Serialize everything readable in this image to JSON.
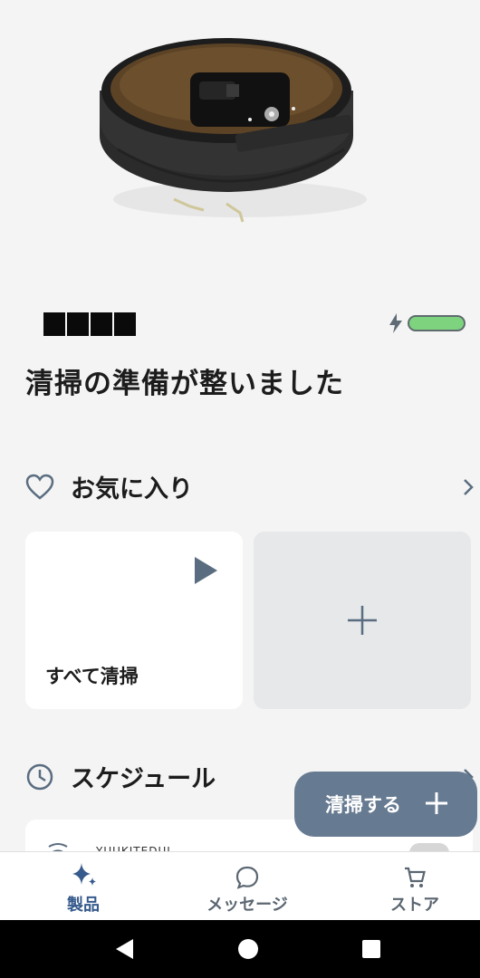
{
  "robot": {
    "name": "████",
    "battery_charging": true,
    "battery_level": 1.0,
    "status": "清掃の準備が整いました"
  },
  "favorites": {
    "title": "お気に入り",
    "cards": [
      {
        "label": "すべて清掃",
        "action": "play-icon"
      },
      {
        "label": "",
        "action": "plus-icon"
      }
    ]
  },
  "schedule": {
    "title": "スケジュール",
    "items": [
      {
        "name": "YUUKITEDUI"
      }
    ]
  },
  "fab": {
    "label": "清掃する"
  },
  "nav": {
    "items": [
      {
        "label": "製品",
        "icon": "sparkle-icon",
        "active": true
      },
      {
        "label": "メッセージ",
        "icon": "chat-bubble-icon",
        "active": false
      },
      {
        "label": "ストア",
        "icon": "cart-icon",
        "active": false
      }
    ]
  },
  "colors": {
    "accent": "#667a91",
    "active_nav": "#365a8c",
    "battery": "#7ed37e"
  }
}
